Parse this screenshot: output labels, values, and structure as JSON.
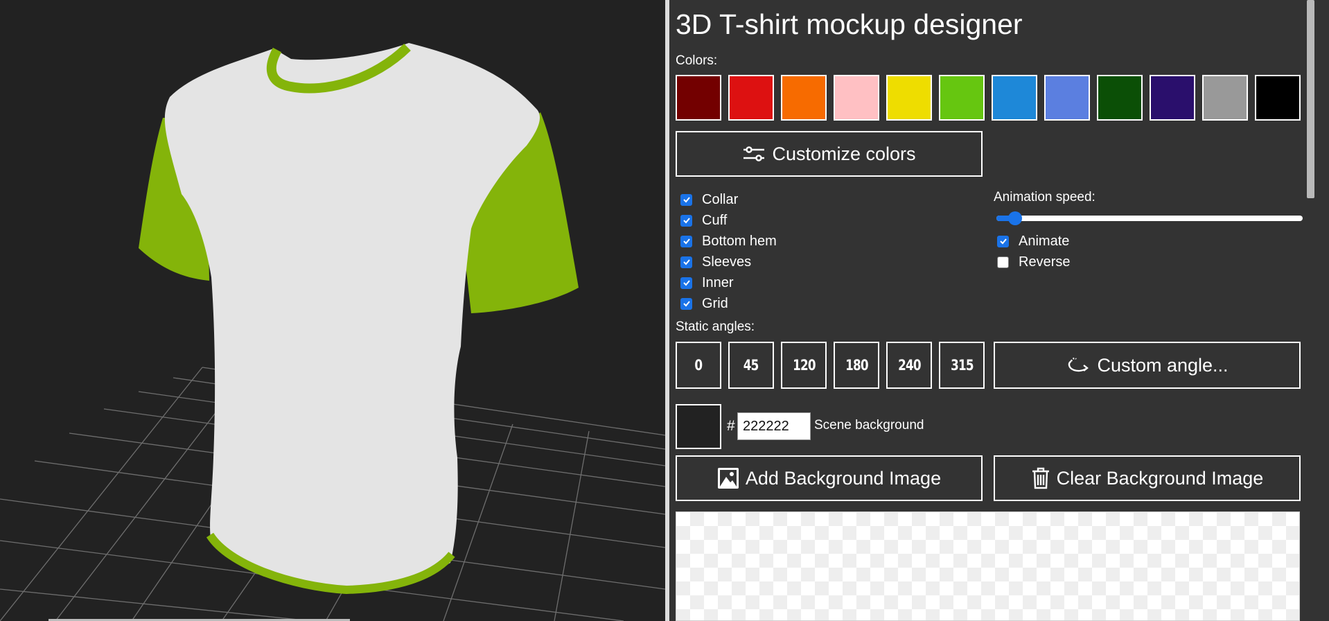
{
  "app": {
    "title": "3D T-shirt mockup designer"
  },
  "colors": {
    "label": "Colors:",
    "swatches": [
      {
        "name": "dark-red",
        "hex": "#730000"
      },
      {
        "name": "red",
        "hex": "#dd1111"
      },
      {
        "name": "orange",
        "hex": "#f76b00"
      },
      {
        "name": "pink",
        "hex": "#ffc0c3"
      },
      {
        "name": "yellow",
        "hex": "#eedd00"
      },
      {
        "name": "green",
        "hex": "#66c610"
      },
      {
        "name": "blue",
        "hex": "#1e88d8"
      },
      {
        "name": "periwinkle",
        "hex": "#5b7fe0"
      },
      {
        "name": "dark-green",
        "hex": "#0b4f06"
      },
      {
        "name": "indigo",
        "hex": "#2a0f6c"
      },
      {
        "name": "gray",
        "hex": "#999999"
      },
      {
        "name": "black",
        "hex": "#000000"
      }
    ],
    "customize_label": "Customize colors",
    "customize_icon": "sliders-icon"
  },
  "options": {
    "items": [
      {
        "label": "Collar",
        "checked": true
      },
      {
        "label": "Cuff",
        "checked": true
      },
      {
        "label": "Bottom hem",
        "checked": true
      },
      {
        "label": "Sleeves",
        "checked": true
      },
      {
        "label": "Inner",
        "checked": true
      },
      {
        "label": "Grid",
        "checked": true
      }
    ]
  },
  "animation": {
    "speed_label": "Animation speed:",
    "speed_value": 0.03,
    "animate": {
      "label": "Animate",
      "checked": true
    },
    "reverse": {
      "label": "Reverse",
      "checked": false
    }
  },
  "angles": {
    "label": "Static angles:",
    "values": [
      "0",
      "45",
      "120",
      "180",
      "240",
      "315"
    ],
    "custom_label": "Custom angle...",
    "custom_icon": "rotate-icon"
  },
  "scene": {
    "hash": "#",
    "bg_hex": "222222",
    "bg_color": "#222222",
    "bg_label": "Scene background",
    "add_bg_label": "Add Background Image",
    "add_bg_icon": "image-icon",
    "clear_bg_label": "Clear Background Image",
    "clear_bg_icon": "trash-icon"
  },
  "model": {
    "body_color": "#e4e4e4",
    "trim_color": "#84b40a"
  }
}
